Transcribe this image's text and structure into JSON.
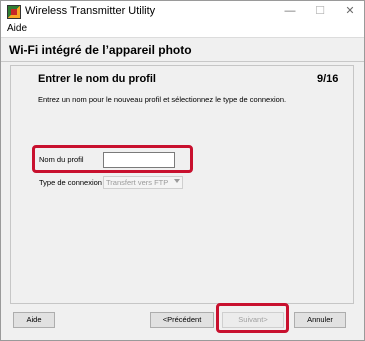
{
  "window": {
    "title": "Wireless Transmitter Utility",
    "controls": {
      "minimize": "—",
      "maximize": "☐",
      "close": "✕"
    }
  },
  "menu": {
    "items": [
      "Aide"
    ]
  },
  "header": {
    "title": "Wi-Fi intégré de l’appareil photo"
  },
  "step": {
    "title": "Entrer le nom du profil",
    "counter": "9/16",
    "instructions": "Entrez un nom pour le nouveau profil et sélectionnez le type de connexion."
  },
  "form": {
    "profile_label": "Nom du profil",
    "profile_value": "",
    "connection_label": "Type de connexion",
    "connection_value": "Transfert vers FTP"
  },
  "buttons": {
    "help": "Aide",
    "previous": "<Précédent",
    "next": "Suivant>",
    "cancel": "Annuler"
  },
  "colors": {
    "highlight": "#c8102e",
    "panel": "#f0f0f0"
  }
}
